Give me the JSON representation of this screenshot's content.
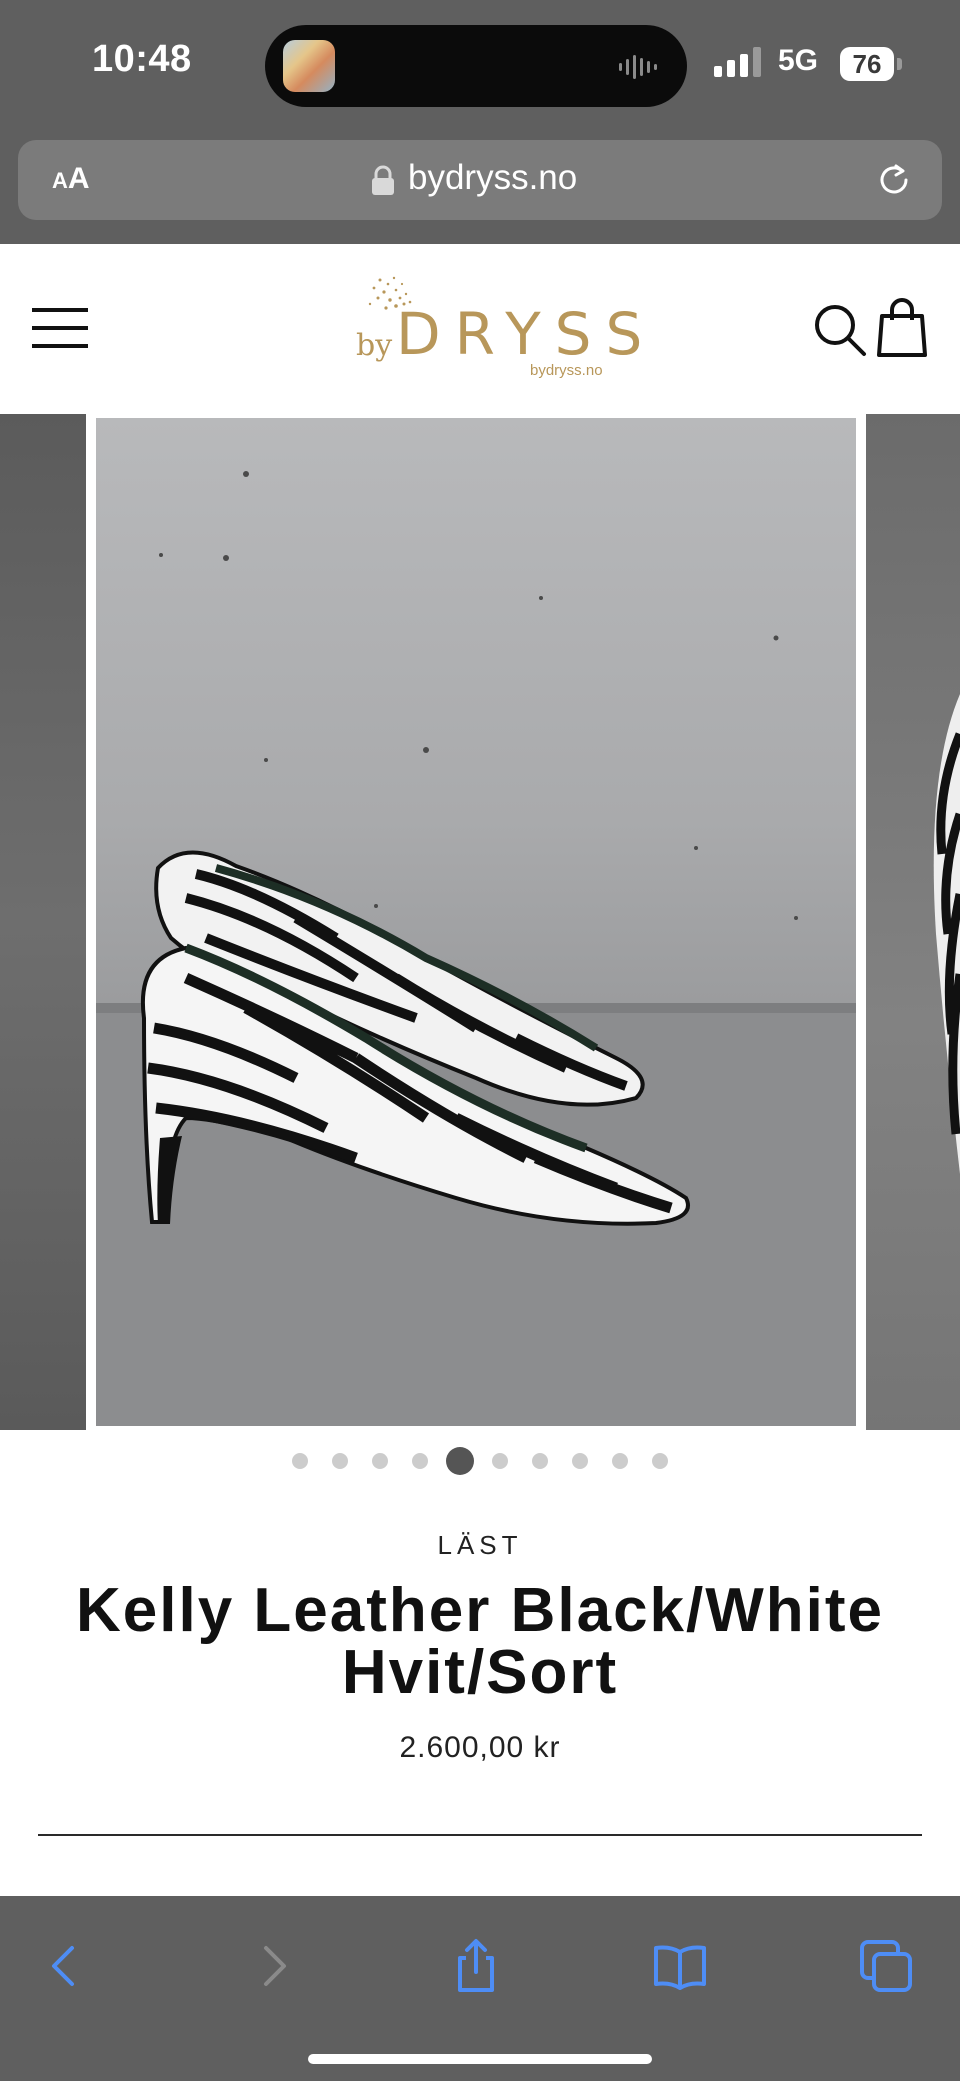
{
  "status_bar": {
    "time": "10:48",
    "network": "5G",
    "battery": "76"
  },
  "browser": {
    "text_size_label_small": "A",
    "text_size_label_large": "A",
    "url": "bydryss.no"
  },
  "store": {
    "logo_prefix": "by",
    "logo_main": "DRYSS",
    "logo_sub": "bydryss.no",
    "accent_color": "#b8975a"
  },
  "gallery": {
    "slide_count": 10,
    "active_index": 4
  },
  "product": {
    "vendor": "LÄST",
    "title": "Kelly Leather Black/White Hvit/Sort",
    "price": "2.600,00 kr"
  },
  "icons": {
    "menu": "hamburger-icon",
    "search": "search-icon",
    "cart": "shopping-bag-icon",
    "back": "chevron-left-icon",
    "forward": "chevron-right-icon",
    "share": "share-icon",
    "bookmarks": "book-icon",
    "tabs": "tabs-icon",
    "lock": "lock-icon",
    "reload": "reload-icon"
  }
}
